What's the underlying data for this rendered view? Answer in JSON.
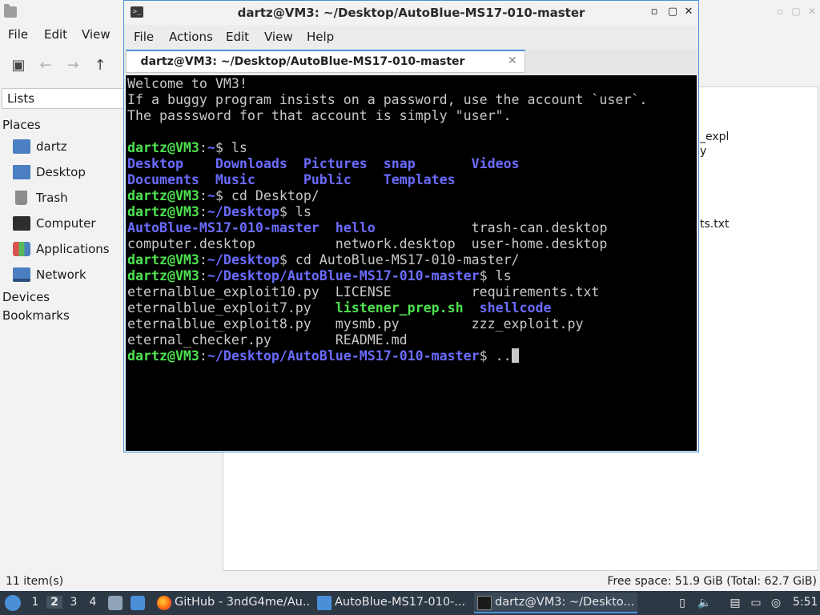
{
  "file_manager": {
    "menu": {
      "file": "File",
      "edit": "Edit",
      "view": "View"
    },
    "sidebar": {
      "lists_label": "Lists",
      "places_label": "Places",
      "items": [
        {
          "label": "dartz",
          "icon": "home-folder-icon"
        },
        {
          "label": "Desktop",
          "icon": "desktop-icon"
        },
        {
          "label": "Trash",
          "icon": "trash-icon"
        },
        {
          "label": "Computer",
          "icon": "computer-icon"
        },
        {
          "label": "Applications",
          "icon": "applications-icon"
        },
        {
          "label": "Network",
          "icon": "network-icon"
        }
      ],
      "devices_label": "Devices",
      "bookmarks_label": "Bookmarks"
    },
    "partial_files": [
      "_expl",
      "y",
      "ts.txt"
    ],
    "status": {
      "item_count": "11 item(s)",
      "free_space": "Free space: 51.9 GiB (Total: 62.7 GiB)"
    }
  },
  "terminal": {
    "title": "dartz@VM3: ~/Desktop/AutoBlue-MS17-010-master",
    "menu": {
      "file": "File",
      "actions": "Actions",
      "edit": "Edit",
      "view": "View",
      "help": "Help"
    },
    "tab_label": "dartz@VM3: ~/Desktop/AutoBlue-MS17-010-master",
    "colors": {
      "prompt": "#4fe24f",
      "path_dir": "#6b6bff",
      "text": "#c8c8c8"
    },
    "lines": [
      [
        [
          "w",
          "Welcome to VM3!"
        ]
      ],
      [
        [
          "w",
          "If a buggy program insists on a password, use the account `user`."
        ]
      ],
      [
        [
          "w",
          "The passsword for that account is simply \"user\"."
        ]
      ],
      [
        [
          "w",
          ""
        ]
      ],
      [
        [
          "g",
          "dartz@VM3"
        ],
        [
          "w",
          ":"
        ],
        [
          "b",
          "~"
        ],
        [
          "w",
          "$ ls"
        ]
      ],
      [
        [
          "b",
          "Desktop"
        ],
        [
          "w",
          "    "
        ],
        [
          "b",
          "Downloads"
        ],
        [
          "w",
          "  "
        ],
        [
          "b",
          "Pictures"
        ],
        [
          "w",
          "  "
        ],
        [
          "b",
          "snap"
        ],
        [
          "w",
          "       "
        ],
        [
          "b",
          "Videos"
        ]
      ],
      [
        [
          "b",
          "Documents"
        ],
        [
          "w",
          "  "
        ],
        [
          "b",
          "Music"
        ],
        [
          "w",
          "      "
        ],
        [
          "b",
          "Public"
        ],
        [
          "w",
          "    "
        ],
        [
          "b",
          "Templates"
        ]
      ],
      [
        [
          "g",
          "dartz@VM3"
        ],
        [
          "w",
          ":"
        ],
        [
          "b",
          "~"
        ],
        [
          "w",
          "$ cd Desktop/"
        ]
      ],
      [
        [
          "g",
          "dartz@VM3"
        ],
        [
          "w",
          ":"
        ],
        [
          "b",
          "~/Desktop"
        ],
        [
          "w",
          "$ ls"
        ]
      ],
      [
        [
          "b",
          "AutoBlue-MS17-010-master"
        ],
        [
          "w",
          "  "
        ],
        [
          "b",
          "hello"
        ],
        [
          "w",
          "            trash-can.desktop"
        ]
      ],
      [
        [
          "w",
          "computer.desktop          network.desktop  user-home.desktop"
        ]
      ],
      [
        [
          "g",
          "dartz@VM3"
        ],
        [
          "w",
          ":"
        ],
        [
          "b",
          "~/Desktop"
        ],
        [
          "w",
          "$ cd AutoBlue-MS17-010-master/"
        ]
      ],
      [
        [
          "g",
          "dartz@VM3"
        ],
        [
          "w",
          ":"
        ],
        [
          "b",
          "~/Desktop/AutoBlue-MS17-010-master"
        ],
        [
          "w",
          "$ ls"
        ]
      ],
      [
        [
          "w",
          "eternalblue_exploit10.py  LICENSE          requirements.txt"
        ]
      ],
      [
        [
          "w",
          "eternalblue_exploit7.py   "
        ],
        [
          "g",
          "listener_prep.sh"
        ],
        [
          "w",
          "  "
        ],
        [
          "b",
          "shellcode"
        ]
      ],
      [
        [
          "w",
          "eternalblue_exploit8.py   mysmb.py         zzz_exploit.py"
        ]
      ],
      [
        [
          "w",
          "eternal_checker.py        README.md"
        ]
      ],
      [
        [
          "g",
          "dartz@VM3"
        ],
        [
          "w",
          ":"
        ],
        [
          "b",
          "~/Desktop/AutoBlue-MS17-010-master"
        ],
        [
          "w",
          "$ .."
        ]
      ]
    ]
  },
  "taskbar": {
    "workspaces": [
      "1",
      "2",
      "3",
      "4"
    ],
    "tasks": [
      {
        "label": "GitHub - 3ndG4me/Au..."
      },
      {
        "label": "AutoBlue-MS17-010-..."
      },
      {
        "label": "dartz@VM3: ~/Deskto..."
      }
    ],
    "clock": "5:51"
  }
}
